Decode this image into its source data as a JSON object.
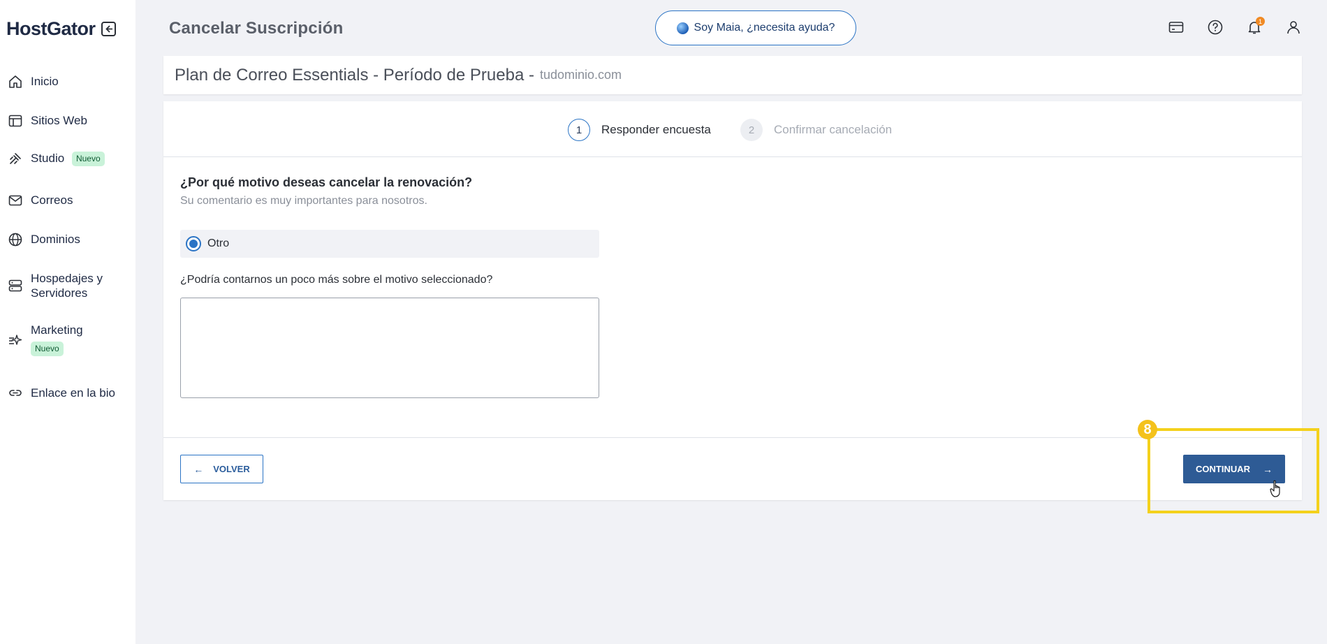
{
  "sidebar": {
    "brand": "HostGator",
    "items": [
      {
        "label": "Inicio",
        "icon": "home-icon"
      },
      {
        "label": "Sitios Web",
        "icon": "layout-icon"
      },
      {
        "label": "Studio",
        "icon": "studio-icon",
        "badge": "Nuevo"
      },
      {
        "label": "Correos",
        "icon": "mail-icon"
      },
      {
        "label": "Dominios",
        "icon": "globe-icon"
      },
      {
        "label": "Hospedajes y Servidores",
        "icon": "server-icon"
      },
      {
        "label": "Marketing",
        "icon": "sparkles-icon",
        "badge": "Nuevo"
      },
      {
        "label": "Enlace en la bio",
        "icon": "link-icon"
      }
    ]
  },
  "header": {
    "title": "Cancelar Suscripción",
    "assistant_label": "Soy Maia, ¿necesita ayuda?",
    "notification_count": "1"
  },
  "plan": {
    "name": "Plan de Correo Essentials - Período de Prueba -",
    "domain": "tudominio.com"
  },
  "steps": [
    {
      "number": "1",
      "label": "Responder encuesta",
      "active": true
    },
    {
      "number": "2",
      "label": "Confirmar cancelación",
      "active": false
    }
  ],
  "survey": {
    "question": "¿Por qué motivo deseas cancelar la renovación?",
    "subtext": "Su comentario es muy importantes para nosotros.",
    "option_label": "Otro",
    "more_label": "¿Podría contarnos un poco más sobre el motivo seleccionado?",
    "comment_value": ""
  },
  "actions": {
    "back_label": "VOLVER",
    "continue_label": "CONTINUAR"
  },
  "annotation": {
    "step_number": "8"
  },
  "colors": {
    "accent": "#2b74c5",
    "primary_button": "#2e5b95",
    "highlight": "#f4d11c",
    "badge_bg": "#c9f2d9"
  }
}
